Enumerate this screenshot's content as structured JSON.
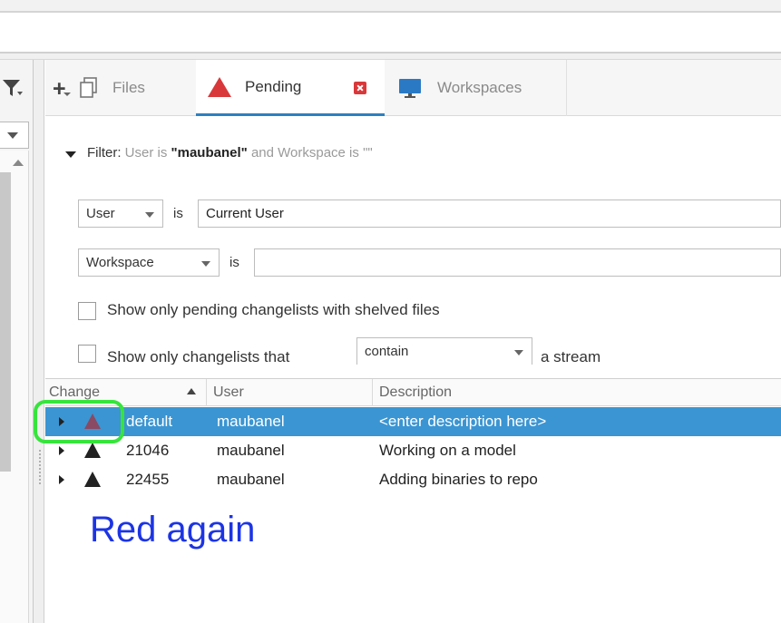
{
  "tabs": [
    {
      "label": "Files",
      "icon": "files-icon"
    },
    {
      "label": "Pending",
      "icon": "pending-changelist-icon",
      "active": true
    },
    {
      "label": "Workspaces",
      "icon": "workspace-monitor-icon"
    }
  ],
  "filter": {
    "prefix": "Filter:",
    "summary_pre": "User is",
    "summary_user": "\"maubanel\"",
    "summary_mid": "and Workspace is",
    "summary_ws": "\"\"",
    "row1": {
      "field": "User",
      "op": "is",
      "value": "Current User"
    },
    "row2": {
      "field": "Workspace",
      "op": "is",
      "value": ""
    },
    "check_shelved": {
      "label": "Show only pending changelists with shelved files",
      "checked": false
    },
    "check_stream": {
      "label_pre": "Show only changelists that",
      "combo": "contain",
      "label_post": "a stream",
      "checked": false
    }
  },
  "table": {
    "columns": [
      "Change",
      "User",
      "Description"
    ],
    "rows": [
      {
        "change": "default",
        "user": "maubanel",
        "description": "<enter description here>",
        "selected": true
      },
      {
        "change": "21046",
        "user": "maubanel",
        "description": "Working on a model",
        "selected": false
      },
      {
        "change": "22455",
        "user": "maubanel",
        "description": "Adding binaries to repo",
        "selected": false
      }
    ]
  },
  "annotation": {
    "text": "Red again",
    "color": "#1c34e4",
    "highlight_color": "#37e43c"
  },
  "colors": {
    "selection": "#3b95d2",
    "pending_red": "#d9383a",
    "tab_underline": "#2e7fc0"
  }
}
